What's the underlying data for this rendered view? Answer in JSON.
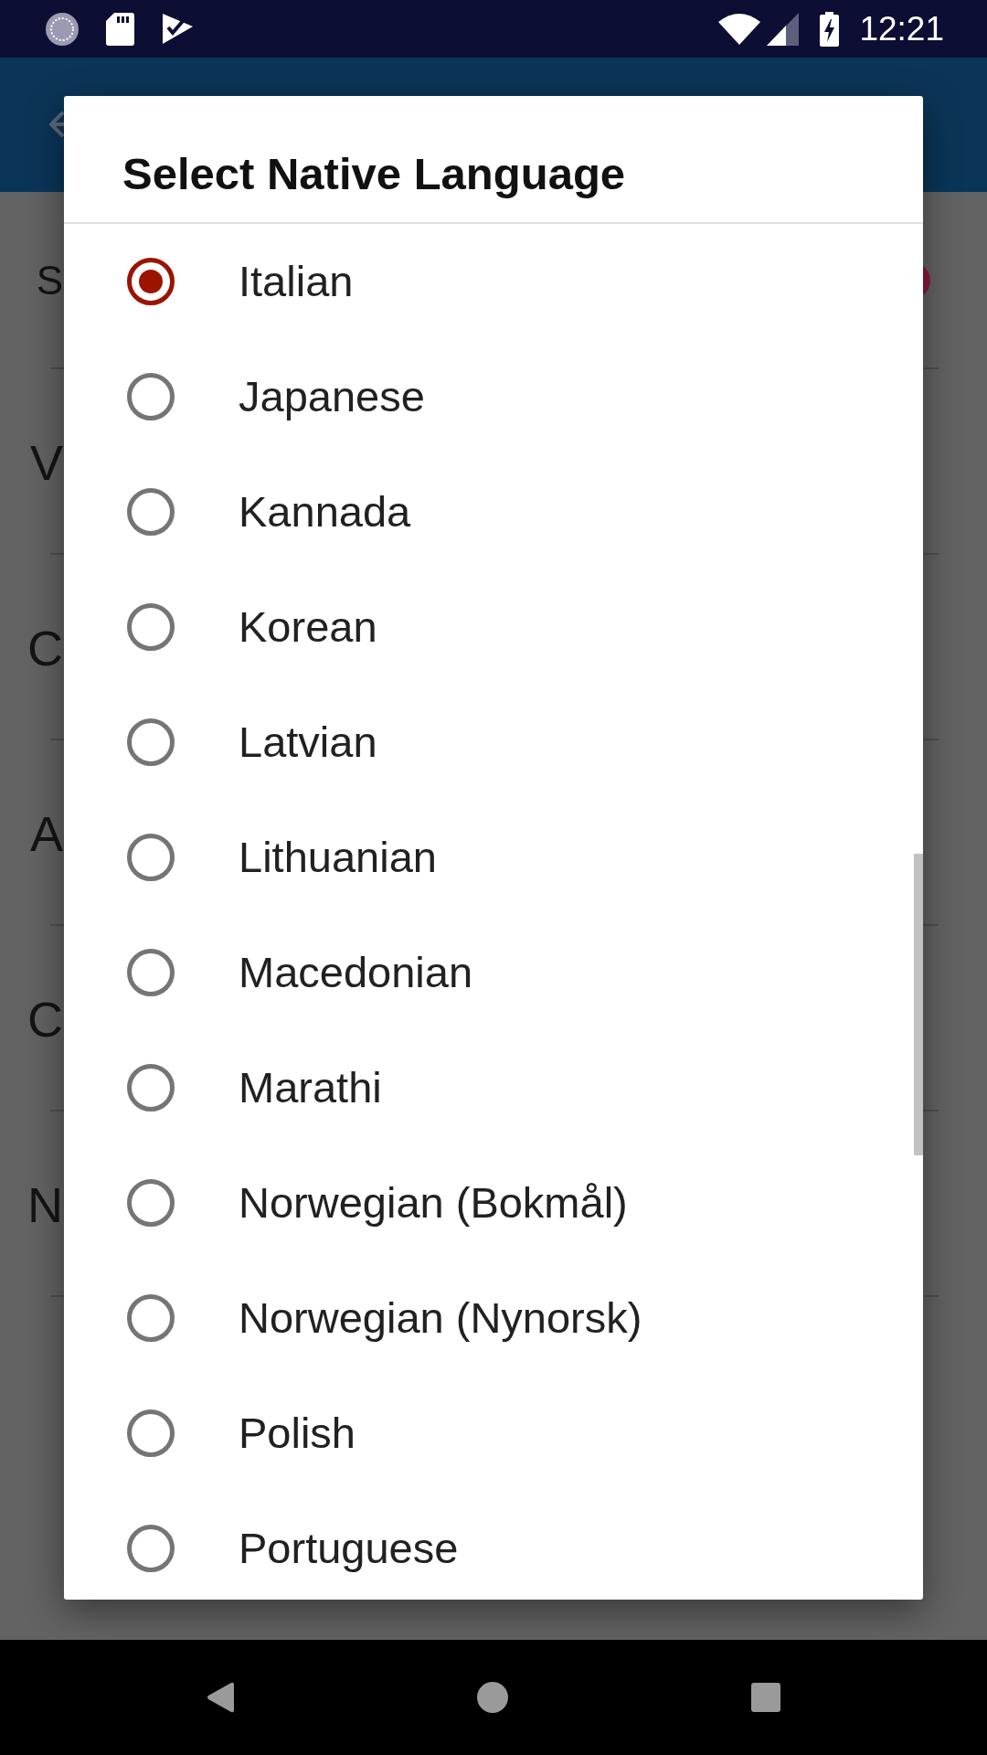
{
  "status_bar": {
    "time": "12:21"
  },
  "screen": {
    "rows": [
      {
        "label": "S"
      },
      {
        "label": "V"
      },
      {
        "label": "C"
      },
      {
        "label": "A"
      },
      {
        "label": "C"
      },
      {
        "label": "N"
      }
    ]
  },
  "dialog": {
    "title": "Select Native Language",
    "options": [
      {
        "label": "Italian",
        "selected": true
      },
      {
        "label": "Japanese",
        "selected": false
      },
      {
        "label": "Kannada",
        "selected": false
      },
      {
        "label": "Korean",
        "selected": false
      },
      {
        "label": "Latvian",
        "selected": false
      },
      {
        "label": "Lithuanian",
        "selected": false
      },
      {
        "label": "Macedonian",
        "selected": false
      },
      {
        "label": "Marathi",
        "selected": false
      },
      {
        "label": "Norwegian (Bokmål)",
        "selected": false
      },
      {
        "label": "Norwegian (Nynorsk)",
        "selected": false
      },
      {
        "label": "Polish",
        "selected": false
      },
      {
        "label": "Portuguese",
        "selected": false
      }
    ]
  }
}
